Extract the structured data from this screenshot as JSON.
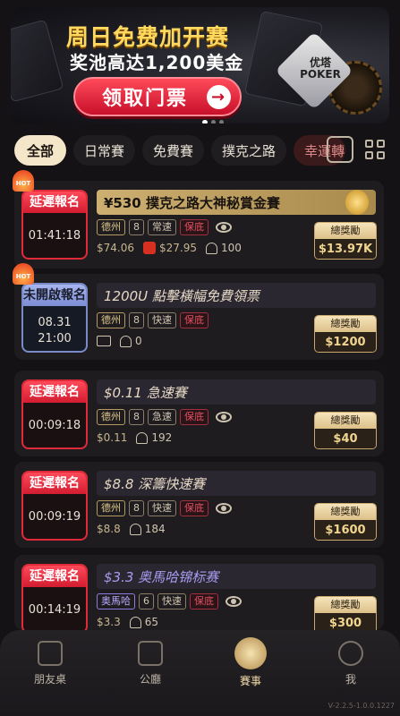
{
  "banner": {
    "title": "周日免费加开赛",
    "subtitle": "奖池高达1,200美金",
    "button": "领取门票",
    "button_arrow": "→",
    "logo": "优塔 POKER"
  },
  "tabs": [
    "全部",
    "日常賽",
    "免費賽",
    "撲克之路",
    "幸運轉盤"
  ],
  "tournaments": [
    {
      "hot": "HOT",
      "status": "延遲報名",
      "time": "01:41:18",
      "title": "¥530 撲克之路大神秘賞金賽",
      "tags": [
        "德州",
        "8",
        "常速",
        "保底"
      ],
      "fee": "$74.06",
      "bounty": "$27.95",
      "players": "100",
      "prize_label": "總獎勵",
      "prize": "$13.97K"
    },
    {
      "hot": "HOT",
      "status": "未開啟報名",
      "date": "08.31",
      "time": "21:00",
      "title": "1200U 點擊橫幅免費領票",
      "tags": [
        "德州",
        "8",
        "快速",
        "保底"
      ],
      "players": "0",
      "prize_label": "總獎勵",
      "prize": "$1200"
    },
    {
      "status": "延遲報名",
      "time": "00:09:18",
      "title": "$0.11 急速賽",
      "tags": [
        "德州",
        "8",
        "急速",
        "保底"
      ],
      "fee": "$0.11",
      "players": "192",
      "prize_label": "總獎勵",
      "prize": "$40"
    },
    {
      "status": "延遲報名",
      "time": "00:09:19",
      "title": "$8.8 深籌快速賽",
      "tags": [
        "德州",
        "8",
        "快速",
        "保底"
      ],
      "fee": "$8.8",
      "players": "184",
      "prize_label": "總獎勵",
      "prize": "$1600"
    },
    {
      "status": "延遲報名",
      "time": "00:14:19",
      "title": "$3.3 奥馬哈锦标赛",
      "tags": [
        "奥馬哈",
        "6",
        "快速",
        "保底"
      ],
      "fee": "$3.3",
      "players": "65",
      "prize_label": "總獎勵",
      "prize": "$300"
    }
  ],
  "nav": [
    "朋友桌",
    "公廳",
    "賽事",
    "我"
  ],
  "version": "V-2.2.5-1.0.0.1227",
  "colors": {
    "accent": "#f4e6c8",
    "status_red": "#e02a3a",
    "status_blue": "#a7b5f0",
    "gold": "#f0d490"
  }
}
